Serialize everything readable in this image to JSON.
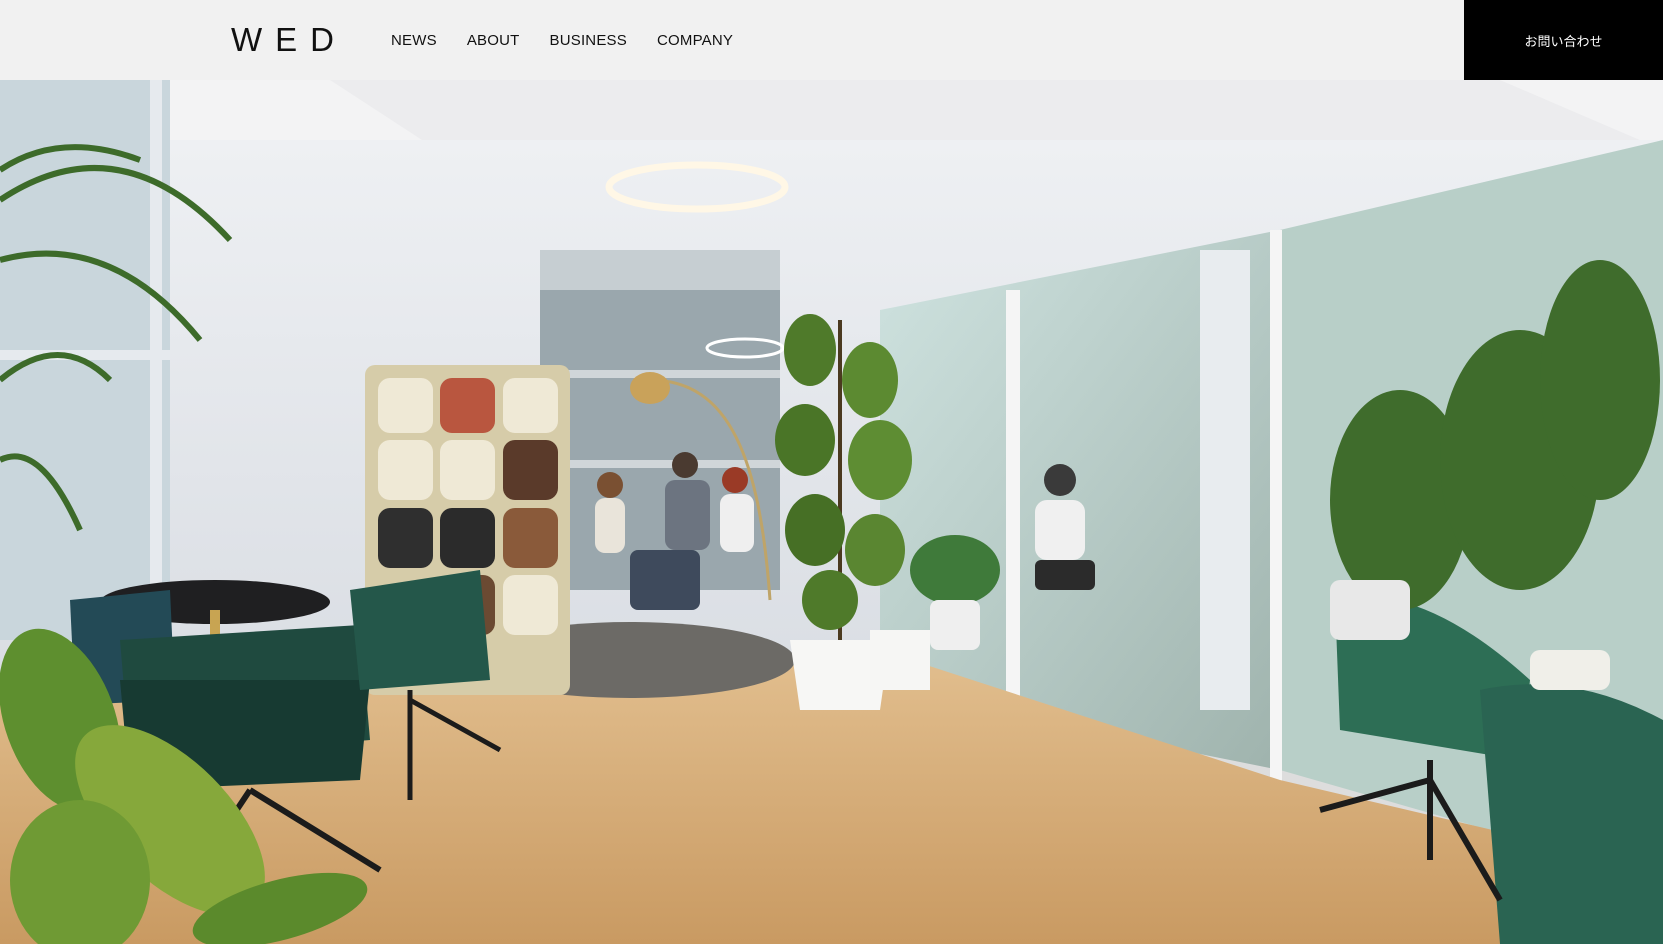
{
  "header": {
    "logo": "WED",
    "nav": [
      {
        "label": "NEWS"
      },
      {
        "label": "ABOUT"
      },
      {
        "label": "BUSINESS"
      },
      {
        "label": "COMPANY"
      }
    ],
    "contact_label": "お問い合わせ"
  },
  "hero": {
    "scene": "office-lounge-photo"
  },
  "colors": {
    "header_bg": "#f1f1f1",
    "contact_bg": "#000000",
    "text": "#111111"
  }
}
